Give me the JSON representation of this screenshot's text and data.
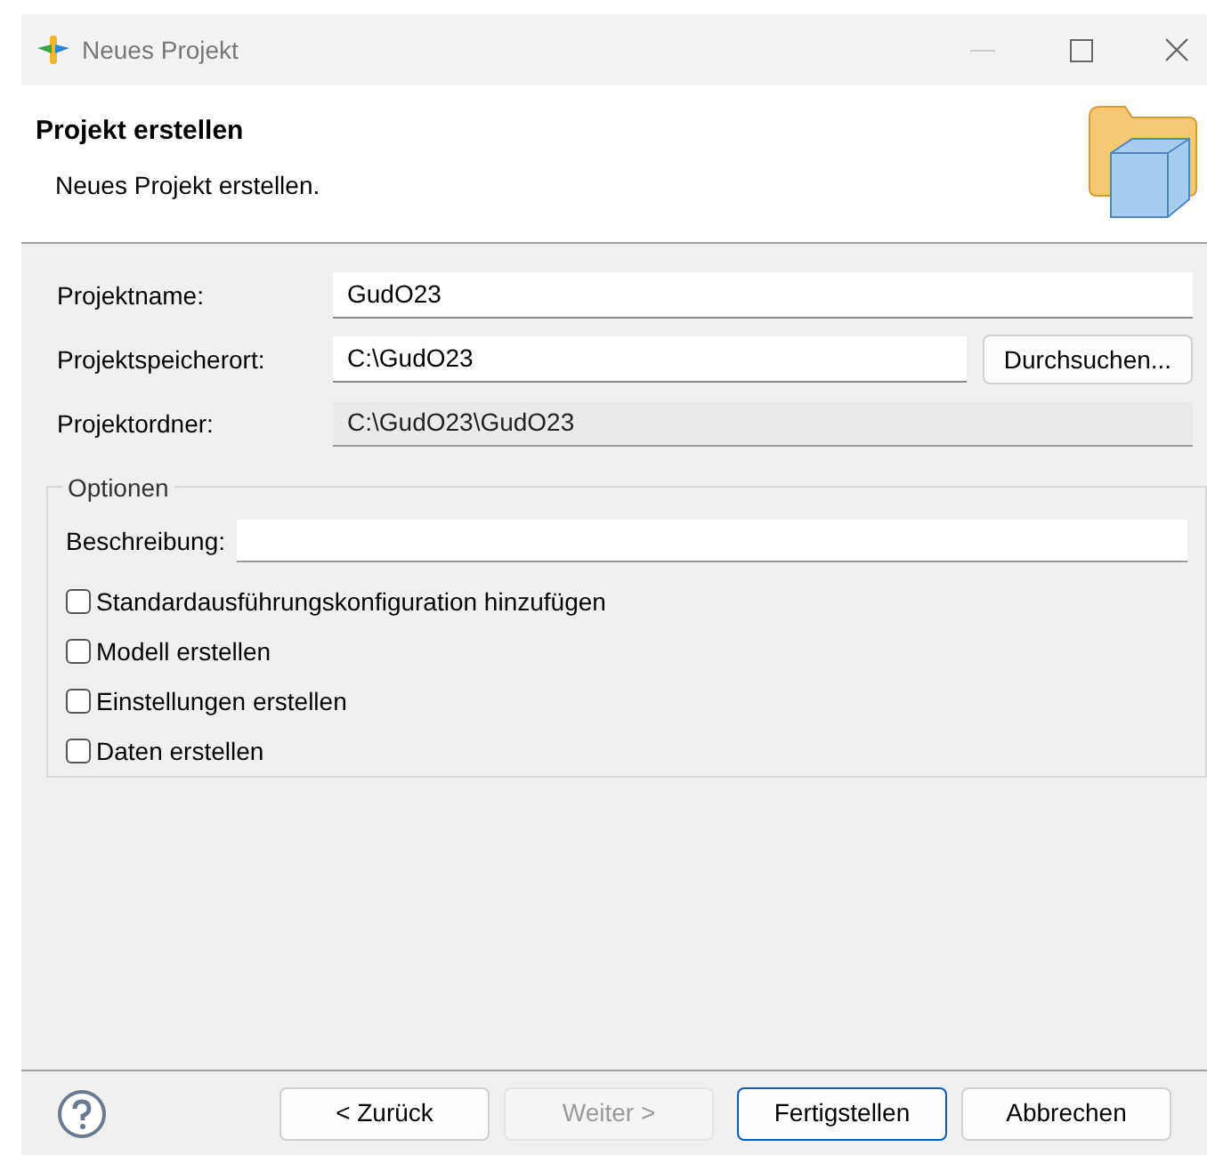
{
  "window": {
    "title": "Neues Projekt"
  },
  "header": {
    "title": "Projekt erstellen",
    "description": "Neues Projekt erstellen."
  },
  "fields": [
    {
      "kind": "text",
      "label": "Projektname:",
      "value": "GudO23"
    },
    {
      "kind": "browse",
      "label": "Projektspeicherort:",
      "value": "C:\\GudO23",
      "button": "Durchsuchen..."
    },
    {
      "kind": "readonly",
      "label": "Projektordner:",
      "value": "C:\\GudO23\\GudO23"
    }
  ],
  "options": {
    "title": "Optionen",
    "description_label": "Beschreibung:",
    "checkboxes": [
      {
        "label": "Standardausführungskonfiguration hinzufügen",
        "checked": false
      },
      {
        "label": "Modell erstellen",
        "checked": false
      },
      {
        "label": "Einstellungen erstellen",
        "checked": false
      },
      {
        "label": "Daten erstellen",
        "checked": false
      }
    ]
  },
  "buttons": [
    {
      "label": "< Zurück",
      "disabled": false,
      "default": false
    },
    {
      "label": "Weiter >",
      "disabled": true,
      "default": false
    },
    {
      "label": "Fertigstellen",
      "disabled": false,
      "default": true
    },
    {
      "label": "Abbrechen",
      "disabled": false,
      "default": false
    }
  ]
}
